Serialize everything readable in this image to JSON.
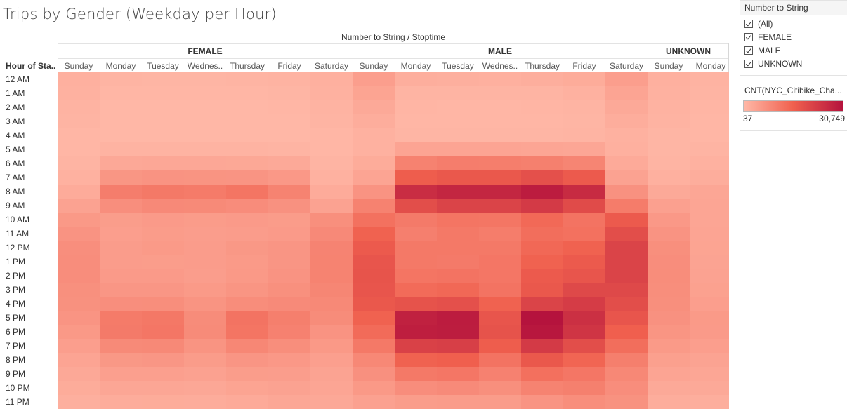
{
  "title": "Trips by Gender (Weekday per Hour)",
  "column_header": "Number to String / Stoptime",
  "row_header": "Hour of Sta..",
  "groups": [
    "FEMALE",
    "MALE",
    "UNKNOWN"
  ],
  "days_display": [
    "Sunday",
    "Monday",
    "Tuesday",
    "Wednes..",
    "Thursday",
    "Friday",
    "Saturday"
  ],
  "hours": [
    "12 AM",
    "1 AM",
    "2 AM",
    "3 AM",
    "4 AM",
    "5 AM",
    "6 AM",
    "7 AM",
    "8 AM",
    "9 AM",
    "10 AM",
    "11 AM",
    "12 PM",
    "1 PM",
    "2 PM",
    "3 PM",
    "4 PM",
    "5 PM",
    "6 PM",
    "7 PM",
    "8 PM",
    "9 PM",
    "10 PM",
    "11 PM"
  ],
  "filter": {
    "title": "Number to String",
    "items": [
      "(All)",
      "FEMALE",
      "MALE",
      "UNKNOWN"
    ]
  },
  "legend": {
    "title": "CNT(NYC_Citibike_Cha...",
    "min_label": "37",
    "max_label": "30,749",
    "colors": [
      "#ffb8a7",
      "#f0604e",
      "#b5133d"
    ]
  },
  "chart_data": {
    "type": "heatmap",
    "title": "Trips by Gender (Weekday per Hour)",
    "color_range": [
      37,
      30749
    ],
    "x_groups": [
      "FEMALE",
      "MALE",
      "UNKNOWN"
    ],
    "x_days": [
      "Sunday",
      "Monday",
      "Tuesday",
      "Wednesday",
      "Thursday",
      "Friday",
      "Saturday"
    ],
    "y": [
      "12 AM",
      "1 AM",
      "2 AM",
      "3 AM",
      "4 AM",
      "5 AM",
      "6 AM",
      "7 AM",
      "8 AM",
      "9 AM",
      "10 AM",
      "11 AM",
      "12 PM",
      "1 PM",
      "2 PM",
      "3 PM",
      "4 PM",
      "5 PM",
      "6 PM",
      "7 PM",
      "8 PM",
      "9 PM",
      "10 PM",
      "11 PM"
    ],
    "series": [
      {
        "name": "FEMALE",
        "values": [
          [
            1500,
            700,
            600,
            600,
            700,
            900,
            1500
          ],
          [
            1200,
            400,
            350,
            350,
            400,
            600,
            1200
          ],
          [
            900,
            250,
            200,
            200,
            250,
            400,
            900
          ],
          [
            700,
            150,
            150,
            150,
            150,
            250,
            700
          ],
          [
            400,
            200,
            200,
            200,
            200,
            250,
            400
          ],
          [
            400,
            900,
            900,
            900,
            900,
            800,
            400
          ],
          [
            700,
            2800,
            3000,
            3000,
            2900,
            2600,
            700
          ],
          [
            1200,
            6000,
            6500,
            6400,
            6300,
            5600,
            1200
          ],
          [
            2300,
            10300,
            11000,
            10700,
            11800,
            9300,
            2300
          ],
          [
            3800,
            7300,
            8200,
            8100,
            7700,
            6800,
            3800
          ],
          [
            5500,
            4800,
            5200,
            5000,
            5200,
            5000,
            7200
          ],
          [
            6500,
            4600,
            5000,
            4700,
            4900,
            5200,
            8200
          ],
          [
            7300,
            4900,
            5300,
            4900,
            5700,
            6100,
            9200
          ],
          [
            7500,
            4900,
            4800,
            4900,
            5300,
            6100,
            9300
          ],
          [
            7500,
            5200,
            5200,
            4700,
            5500,
            6500,
            9300
          ],
          [
            7100,
            5900,
            5900,
            5300,
            6200,
            7100,
            8800
          ],
          [
            6900,
            7300,
            7400,
            6400,
            7600,
            8000,
            8300
          ],
          [
            6300,
            10700,
            11200,
            7800,
            12000,
            10000,
            7800
          ],
          [
            5500,
            10800,
            11500,
            7900,
            11800,
            9600,
            6500
          ],
          [
            4600,
            8100,
            8300,
            6400,
            8600,
            7400,
            5500
          ],
          [
            3500,
            5700,
            5900,
            5000,
            6100,
            5600,
            4400
          ],
          [
            2800,
            4400,
            4400,
            4000,
            4800,
            4700,
            3700
          ],
          [
            2200,
            3100,
            3200,
            3000,
            3600,
            3900,
            3400
          ],
          [
            1600,
            2100,
            2200,
            2100,
            2500,
            3000,
            2800
          ]
        ]
      },
      {
        "name": "MALE",
        "values": [
          [
            4500,
            1700,
            1600,
            1500,
            1700,
            2200,
            4500
          ],
          [
            3600,
            800,
            700,
            700,
            800,
            1200,
            3500
          ],
          [
            2700,
            500,
            450,
            450,
            500,
            800,
            2700
          ],
          [
            1900,
            350,
            300,
            300,
            350,
            550,
            1900
          ],
          [
            1200,
            600,
            550,
            550,
            600,
            700,
            1300
          ],
          [
            1300,
            3500,
            3500,
            3500,
            3300,
            3100,
            1400
          ],
          [
            2200,
            9500,
            10300,
            10200,
            9800,
            9000,
            2500
          ],
          [
            3500,
            16000,
            17000,
            17000,
            18500,
            16500,
            3800
          ],
          [
            6500,
            25500,
            27000,
            27000,
            29000,
            26000,
            6800
          ],
          [
            9500,
            19000,
            21000,
            21000,
            23000,
            19500,
            10500
          ],
          [
            12500,
            10800,
            11800,
            11600,
            13800,
            12000,
            16500
          ],
          [
            15000,
            9900,
            11000,
            10400,
            13000,
            12500,
            19000
          ],
          [
            16500,
            11000,
            11000,
            11000,
            14000,
            15000,
            21000
          ],
          [
            17500,
            11000,
            10800,
            11500,
            15000,
            16500,
            21000
          ],
          [
            17800,
            11800,
            12000,
            11500,
            16500,
            17500,
            21000
          ],
          [
            17500,
            13500,
            14000,
            12000,
            17000,
            20000,
            20000
          ],
          [
            17000,
            18000,
            18500,
            15000,
            21000,
            22500,
            19000
          ],
          [
            15000,
            28000,
            29000,
            17500,
            30749,
            25000,
            17500
          ],
          [
            13500,
            28500,
            28800,
            18000,
            30000,
            24000,
            15500
          ],
          [
            11000,
            21500,
            22000,
            16000,
            23000,
            19000,
            13000
          ],
          [
            8500,
            15000,
            15500,
            12000,
            17000,
            14500,
            10000
          ],
          [
            7000,
            11000,
            11500,
            9600,
            12600,
            11500,
            8500
          ],
          [
            5500,
            7500,
            8000,
            7200,
            9300,
            9800,
            7500
          ],
          [
            4000,
            4800,
            5000,
            5000,
            6300,
            7400,
            6700
          ]
        ]
      },
      {
        "name": "UNKNOWN",
        "values": [
          [
            1500,
            900
          ],
          [
            1300,
            700
          ],
          [
            1100,
            500
          ],
          [
            900,
            400
          ],
          [
            600,
            350
          ],
          [
            550,
            700
          ],
          [
            800,
            1200
          ],
          [
            1500,
            1900
          ],
          [
            2700,
            3200
          ],
          [
            4200,
            3300
          ],
          [
            5600,
            3400
          ],
          [
            6500,
            3500
          ],
          [
            7200,
            3600
          ],
          [
            7500,
            3700
          ],
          [
            7600,
            3800
          ],
          [
            7400,
            4100
          ],
          [
            7200,
            4600
          ],
          [
            6800,
            5300
          ],
          [
            6200,
            5200
          ],
          [
            5300,
            4600
          ],
          [
            4300,
            3700
          ],
          [
            3500,
            3200
          ],
          [
            2700,
            2600
          ],
          [
            2000,
            1800
          ]
        ]
      }
    ]
  }
}
